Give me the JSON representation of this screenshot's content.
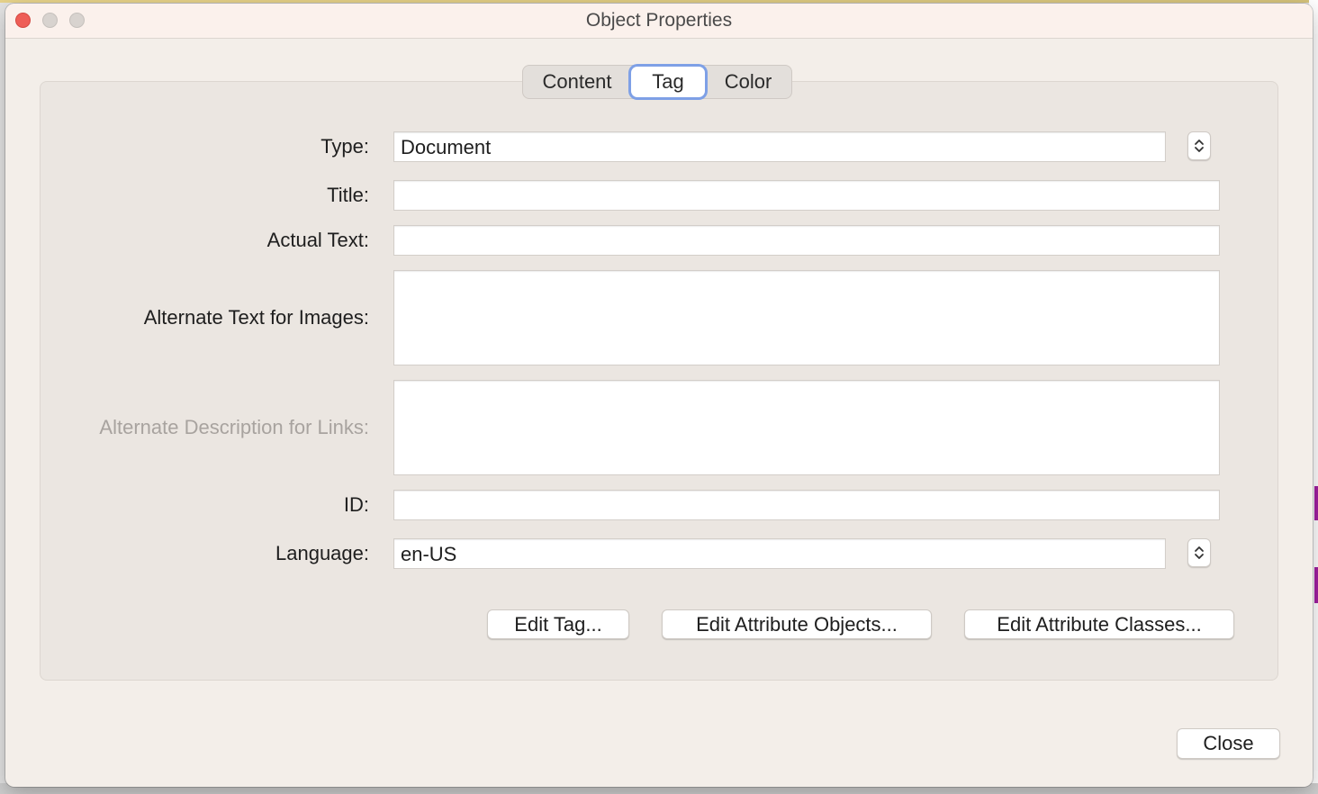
{
  "window": {
    "title": "Object Properties"
  },
  "tabs": [
    {
      "label": "Content",
      "selected": false
    },
    {
      "label": "Tag",
      "selected": true
    },
    {
      "label": "Color",
      "selected": false
    }
  ],
  "form": {
    "type": {
      "label": "Type:",
      "value": "Document"
    },
    "title": {
      "label": "Title:",
      "value": ""
    },
    "actual_text": {
      "label": "Actual Text:",
      "value": ""
    },
    "alt_text_images": {
      "label": "Alternate Text for Images:",
      "value": ""
    },
    "alt_desc_links": {
      "label": "Alternate Description for Links:",
      "value": "",
      "disabled": true
    },
    "id": {
      "label": "ID:",
      "value": ""
    },
    "language": {
      "label": "Language:",
      "value": "en-US"
    }
  },
  "buttons": {
    "edit_tag": "Edit Tag...",
    "edit_attribute_objects": "Edit Attribute Objects...",
    "edit_attribute_classes": "Edit Attribute Classes...",
    "close": "Close"
  },
  "colors": {
    "close_traffic": "#ee5e57",
    "focus_ring": "#7ea0e6",
    "window_bg": "#f3eee9"
  }
}
